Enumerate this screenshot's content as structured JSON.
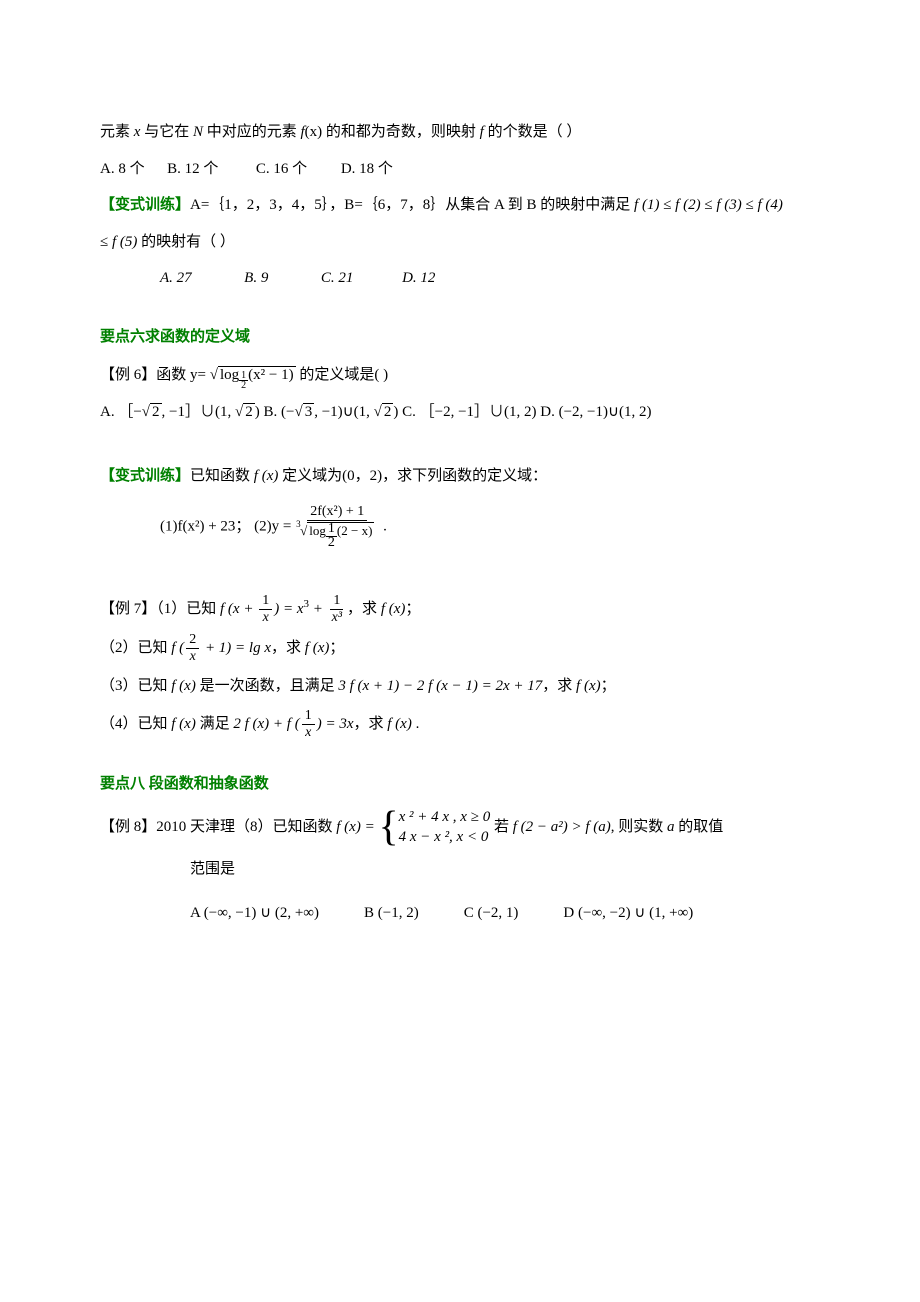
{
  "p1_a": "元素 ",
  "p1_x": "x",
  "p1_b": " 与它在 ",
  "p1_N": "N",
  "p1_c": " 中对应的元素 ",
  "p1_fx": "f",
  "p1_fx2": "(x)",
  "p1_d": " 的和都为奇数，则映射 ",
  "p1_f": "f",
  "p1_e": " 的个数是（   ）",
  "p2": "A. 8 个      B. 12 个          C. 16 个         D. 18 个",
  "var_label": "【变式训练】",
  "var1_a": "A=｛1，2，3，4，5｝，B=｛6，7，8｝从集合 A 到 B 的映射中满足 ",
  "var1_seq": "f (1) ≤ f (2) ≤ f (3) ≤ f (4)",
  "var1_b": "≤ ",
  "var1_c": "f (5)",
  "var1_d": " 的映射有（   ）",
  "var1_choices": "A. 27              B. 9              C. 21             D. 12",
  "sec6": "要点六求函数的定义域",
  "ex6_a": "【例 6】函数 y= ",
  "ex6_b": " 的定义域是(     )",
  "ex6_log": "log",
  "ex6_arg": "(x² − 1)",
  "ex6_choices_a": "A. ［−",
  "ex6_choices_a2": ", −1］∪(1, ",
  "ex6_choices_a3": ")   B. (−",
  "ex6_choices_a4": ", −1)∪(1, ",
  "ex6_choices_a5": ")  C. ［−2, −1］∪(1, 2)   D. (−2, −1)∪(1, 2)",
  "sqrt2": "2",
  "sqrt3": "3",
  "var2_a": "已知函数 ",
  "var2_fx": "f (x)",
  "var2_b": " 定义域为(0，2)，求下列函数的定义域：",
  "var2_eq_a": "(1)f(x²) + 23；  (2)y = ",
  "var2_eq_num": "2f(x²) + 1",
  "var2_eq_den_log": "log",
  "var2_eq_den_arg": "(2 − x)",
  "var2_eq_end": " .",
  "ex7_a": "【例 7】（1）已知 ",
  "ex7_1a": "f (x + ",
  "ex7_1b": ") = x",
  "ex7_1c": " + ",
  "ex7_1d": "，求 ",
  "ex7_1e": "f (x)",
  "ex7_1f": "；",
  "frac_1": "1",
  "frac_x": "x",
  "frac_x3": "x³",
  "sup3": "3",
  "ex7_2_a": "（2）已知 ",
  "ex7_2_b": "f (",
  "ex7_2_c": " + 1) = lg x",
  "ex7_2_d": "，求 ",
  "ex7_2_e": "f (x)",
  "ex7_2_f": "；",
  "frac_2": "2",
  "ex7_3_a": "（3）已知 ",
  "ex7_3_b": "f (x)",
  "ex7_3_c": " 是一次函数，且满足 ",
  "ex7_3_d": "3 f (x + 1) − 2 f (x − 1) = 2x + 17",
  "ex7_3_e": "，求 ",
  "ex7_3_f": "f (x)",
  "ex7_3_g": "；",
  "ex7_4_a": "（4）已知 ",
  "ex7_4_b": "f (x)",
  "ex7_4_c": " 满足 ",
  "ex7_4_d": "2 f (x) + f (",
  "ex7_4_e": ") = 3x",
  "ex7_4_f": "，求 ",
  "ex7_4_g": "f (x)",
  "ex7_4_h": " .",
  "sec8": "要点八 段函数和抽象函数",
  "ex8_a": "【例 8】2010 天津理（8）已知函数 ",
  "ex8_fx": "f (x) = ",
  "ex8_l1": "x ² + 4 x , x ≥ 0",
  "ex8_l2": "4 x − x ², x < 0",
  "ex8_b": " 若 ",
  "ex8_c": "f (2 − a²) > f (a)",
  "ex8_d": ", 则实数 ",
  "ex8_e": "a",
  "ex8_f": " 的取值",
  "ex8_g": "范围是",
  "ex8_ch_a": "A  (−∞, −1) ∪ (2, +∞)",
  "ex8_ch_b": "B  (−1, 2)",
  "ex8_ch_c": "C  (−2, 1)",
  "ex8_ch_d": "D  (−∞, −2) ∪ (1, +∞)"
}
